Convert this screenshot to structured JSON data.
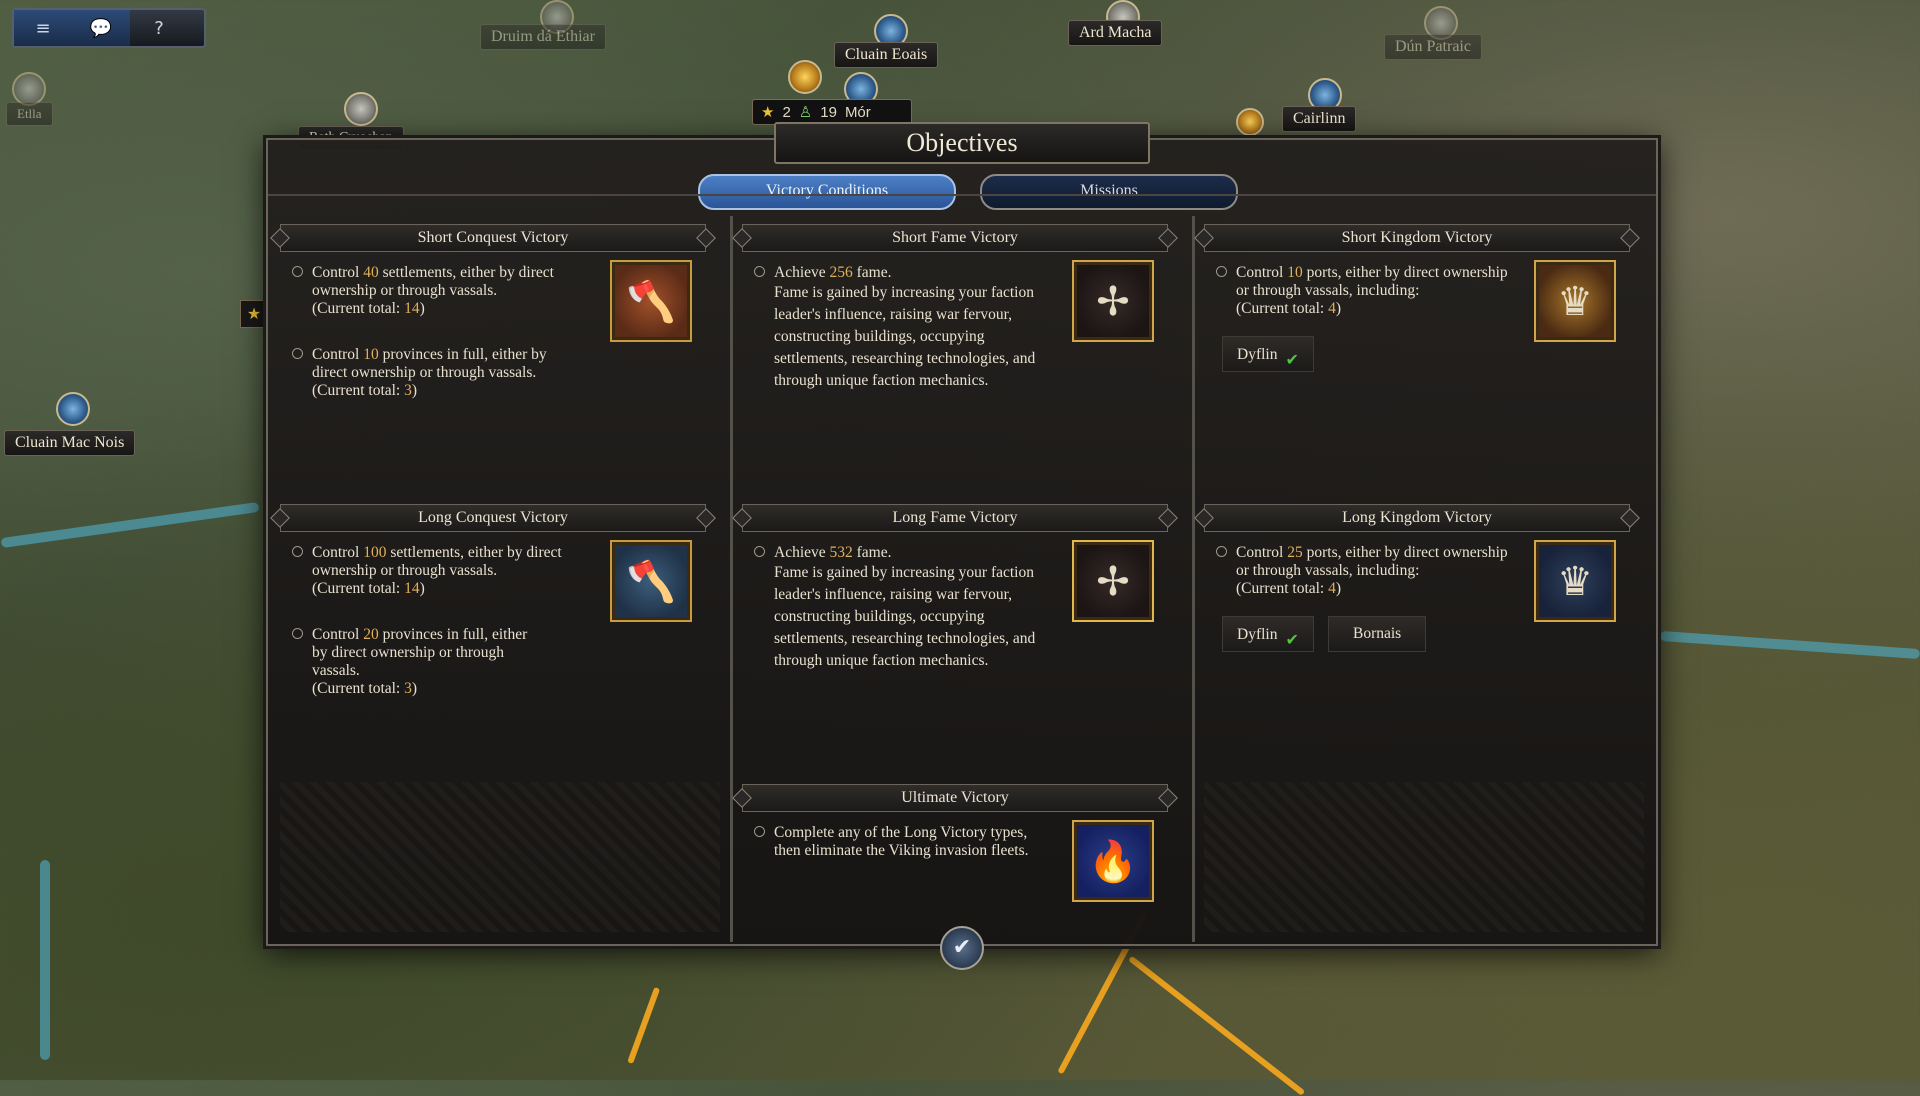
{
  "hud": {
    "menu_icon": "≡",
    "chat_icon": "💬",
    "help_icon": "?"
  },
  "map": {
    "labels": [
      {
        "name": "Druim dá Ethiar",
        "faded": true
      },
      {
        "name": "Cluain Eoais",
        "faded": false
      },
      {
        "name": "Ard Macha",
        "faded": false
      },
      {
        "name": "Dún Patraic",
        "faded": true
      },
      {
        "name": "Rath Cruachan",
        "faded": false
      },
      {
        "name": "Cairlinn",
        "faded": false
      },
      {
        "name": "Cluain Mac Nois",
        "faded": false
      },
      {
        "name": "Etlla",
        "faded": true
      },
      {
        "name": "Mór",
        "faded": false
      }
    ],
    "faction_bar": {
      "stars": "2",
      "troops": "19"
    }
  },
  "dialog": {
    "title": "Objectives",
    "tabs": [
      {
        "label": "Victory Conditions",
        "active": true
      },
      {
        "label": "Missions",
        "active": false
      }
    ],
    "panels": {
      "short_conquest": {
        "title": "Short Conquest Victory",
        "conditions": [
          {
            "pre": "Control ",
            "num": "40",
            "post": " settlements, either by direct ownership or through vassals.",
            "current_pre": "(Current total: ",
            "current": "14",
            "current_post": ")"
          },
          {
            "pre": "Control ",
            "num": "10",
            "post": " provinces in full, either by direct ownership or through vassals.",
            "current_pre": "(Current total: ",
            "current": "3",
            "current_post": ")"
          }
        ],
        "badge_icon": "axe-icon"
      },
      "short_fame": {
        "title": "Short Fame Victory",
        "conditions": [
          {
            "pre": "Achieve ",
            "num": "256",
            "post": " fame.",
            "body": "Fame is gained by increasing your faction leader's influence, raising war fervour, constructing buildings, occupying settlements, researching technologies, and through unique faction mechanics."
          }
        ],
        "badge_icon": "celtic-knot-icon"
      },
      "short_kingdom": {
        "title": "Short Kingdom Victory",
        "conditions": [
          {
            "pre": "Control ",
            "num": "10",
            "post": " ports, either by direct ownership or through vassals, including:",
            "current_pre": "(Current total: ",
            "current": "4",
            "current_post": ")"
          }
        ],
        "ports": [
          {
            "name": "Dyflin",
            "done": true
          }
        ],
        "badge_icon": "gold-crown-icon"
      },
      "long_conquest": {
        "title": "Long Conquest Victory",
        "conditions": [
          {
            "pre": "Control ",
            "num": "100",
            "post": " settlements, either by direct ownership or through vassals.",
            "current_pre": "(Current total: ",
            "current": "14",
            "current_post": ")"
          },
          {
            "pre": "Control ",
            "num": "20",
            "post": " provinces in full, either by direct ownership or through vassals.",
            "current_pre": "(Current total: ",
            "current": "3",
            "current_post": ")"
          }
        ],
        "badge_icon": "axe-icon"
      },
      "long_fame": {
        "title": "Long Fame Victory",
        "conditions": [
          {
            "pre": "Achieve ",
            "num": "532",
            "post": " fame.",
            "body": "Fame is gained by increasing your faction leader's influence, raising war fervour, constructing buildings, occupying settlements, researching technologies, and through unique faction mechanics."
          }
        ],
        "badge_icon": "celtic-knot-icon"
      },
      "long_kingdom": {
        "title": "Long Kingdom Victory",
        "conditions": [
          {
            "pre": "Control ",
            "num": "25",
            "post": " ports, either by direct ownership or through vassals, including:",
            "current_pre": "(Current total: ",
            "current": "4",
            "current_post": ")"
          }
        ],
        "ports": [
          {
            "name": "Dyflin",
            "done": true
          },
          {
            "name": "Bornais",
            "done": false
          }
        ],
        "badge_icon": "silver-crown-icon"
      },
      "ultimate": {
        "title": "Ultimate Victory",
        "conditions": [
          {
            "text": "Complete any of the Long Victory types, then eliminate the Viking invasion fleets."
          }
        ],
        "badge_icon": "viking-ship-fire-icon"
      }
    },
    "confirm_icon": "✔"
  }
}
